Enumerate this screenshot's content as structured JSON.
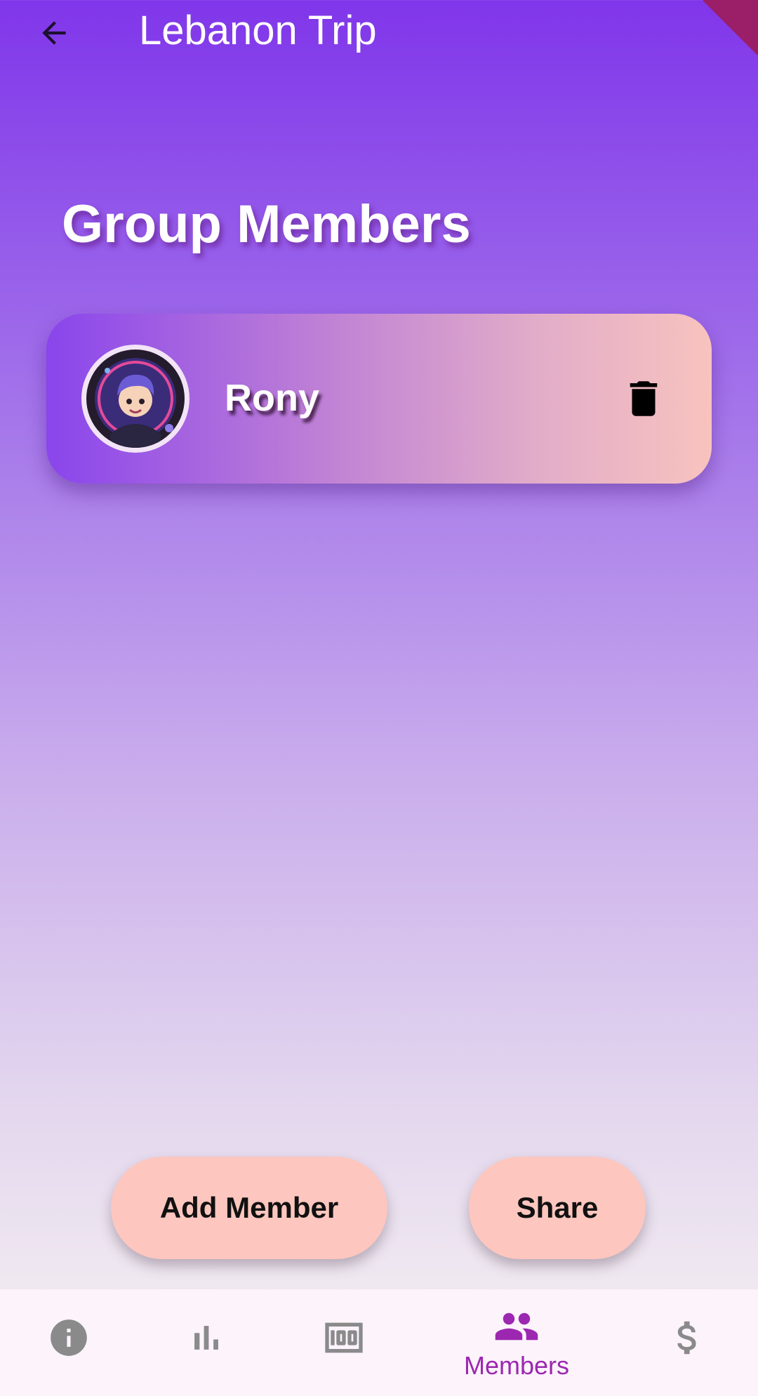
{
  "app_bar": {
    "title": "Lebanon Trip",
    "back_icon": "arrow-left-icon"
  },
  "page": {
    "section_title": "Group Members"
  },
  "members": [
    {
      "name": "Rony",
      "avatar_icon": "avatar-boy-icon",
      "delete_icon": "trash-icon"
    }
  ],
  "actions": {
    "add_member_label": "Add Member",
    "share_label": "Share"
  },
  "bottom_nav": {
    "active_index": 3,
    "items": [
      {
        "icon": "info-icon",
        "label": ""
      },
      {
        "icon": "bar-chart-icon",
        "label": ""
      },
      {
        "icon": "money-icon",
        "label": ""
      },
      {
        "icon": "people-icon",
        "label": "Members"
      },
      {
        "icon": "dollar-icon",
        "label": ""
      }
    ]
  },
  "colors": {
    "accent": "#9C27B0",
    "inactive_icon": "#8A8A8A",
    "button_fill": "#FDC6BE",
    "nav_background": "#FCF3FB"
  }
}
